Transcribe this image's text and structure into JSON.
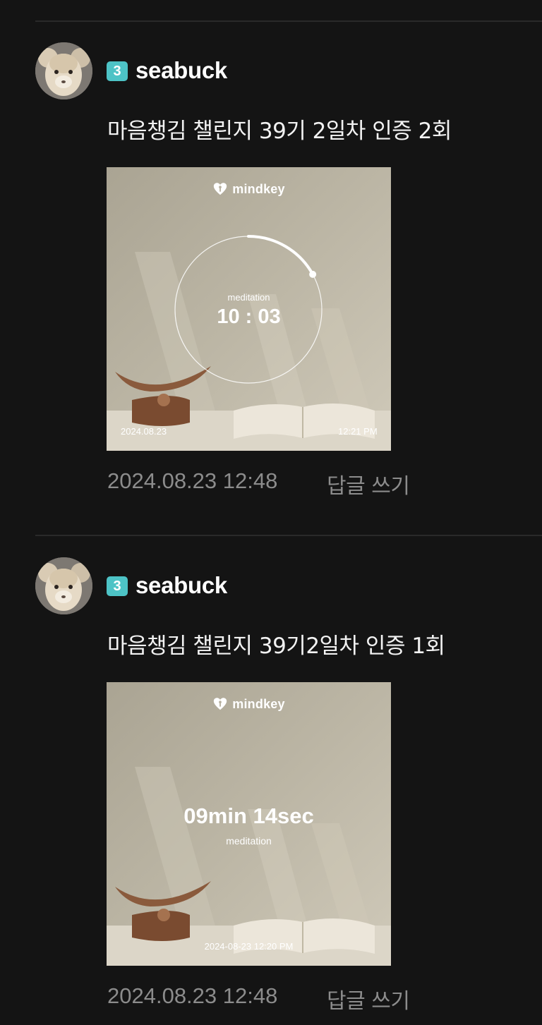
{
  "comments": [
    {
      "level": "3",
      "username": "seabuck",
      "text": "마음챙김 챌린지 39기 2일차 인증 2회",
      "photo": {
        "brand": "mindkey",
        "label": "meditation",
        "timer": "10 : 03",
        "date_stamp": "2024.08.23",
        "time_stamp": "12:21 PM",
        "progress": 0.17
      },
      "timestamp": "2024.08.23 12:48",
      "reply_label": "답글 쓰기"
    },
    {
      "level": "3",
      "username": "seabuck",
      "text": "마음챙김 챌린지 39기2일차 인증 1회",
      "photo": {
        "brand": "mindkey",
        "duration": "09min 14sec",
        "label": "meditation",
        "stamp": "2024-08-23 12:20 PM"
      },
      "timestamp": "2024.08.23 12:48",
      "reply_label": "답글 쓰기"
    }
  ],
  "colors": {
    "background": "#141414",
    "level_badge": "#4dc3c6",
    "meta_text": "#8c8c8c",
    "photo_wall": "#b9b3a2"
  }
}
